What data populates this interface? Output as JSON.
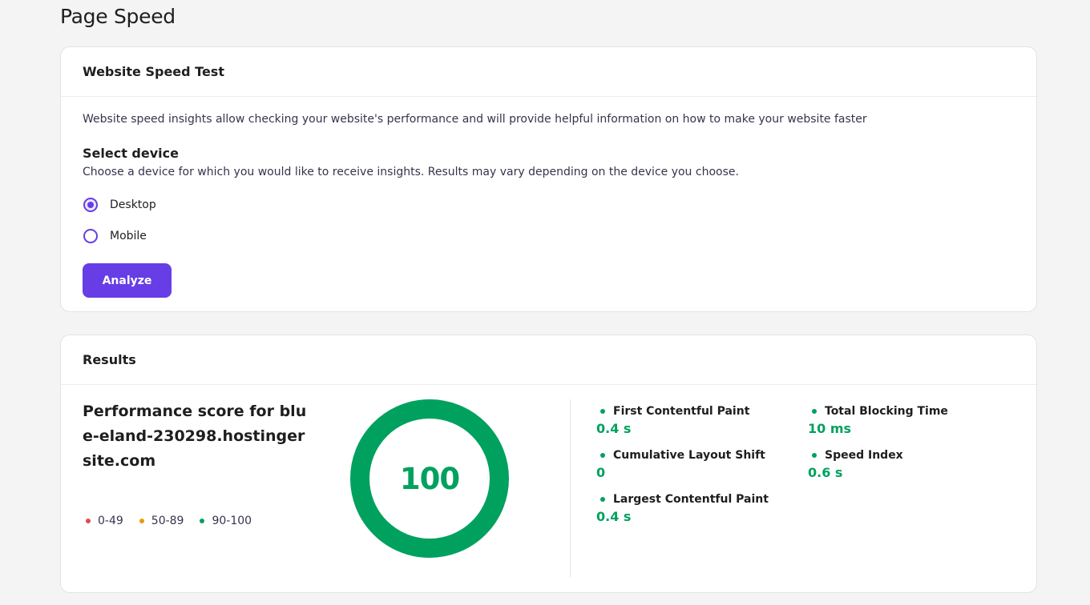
{
  "page": {
    "title": "Page Speed"
  },
  "speed_test": {
    "title": "Website Speed Test",
    "description": "Website speed insights allow checking your website's performance and will provide helpful information on how to make your website faster",
    "select_title": "Select device",
    "select_description": "Choose a device for which you would like to receive insights. Results may vary depending on the device you choose.",
    "devices": [
      {
        "label": "Desktop",
        "selected": true
      },
      {
        "label": "Mobile",
        "selected": false
      }
    ],
    "analyze_label": "Analyze"
  },
  "results": {
    "title": "Results",
    "score_title": "Performance score for blue-eland-230298.hostingersite.com",
    "score": "100",
    "score_fraction": 1.0,
    "legend": [
      {
        "label": "0-49",
        "color": "#e5484d"
      },
      {
        "label": "50-89",
        "color": "#ea9a0f"
      },
      {
        "label": "90-100",
        "color": "#00a15f"
      }
    ],
    "metrics": {
      "fcp": {
        "name": "First Contentful Paint",
        "value": "0.4 s"
      },
      "cls": {
        "name": "Cumulative Layout Shift",
        "value": "0"
      },
      "lcp": {
        "name": "Largest Contentful Paint",
        "value": "0.4 s"
      },
      "tbt": {
        "name": "Total Blocking Time",
        "value": "10 ms"
      },
      "si": {
        "name": "Speed Index",
        "value": "0.6 s"
      }
    }
  },
  "colors": {
    "accent": "#673de6",
    "good": "#00a15f"
  }
}
